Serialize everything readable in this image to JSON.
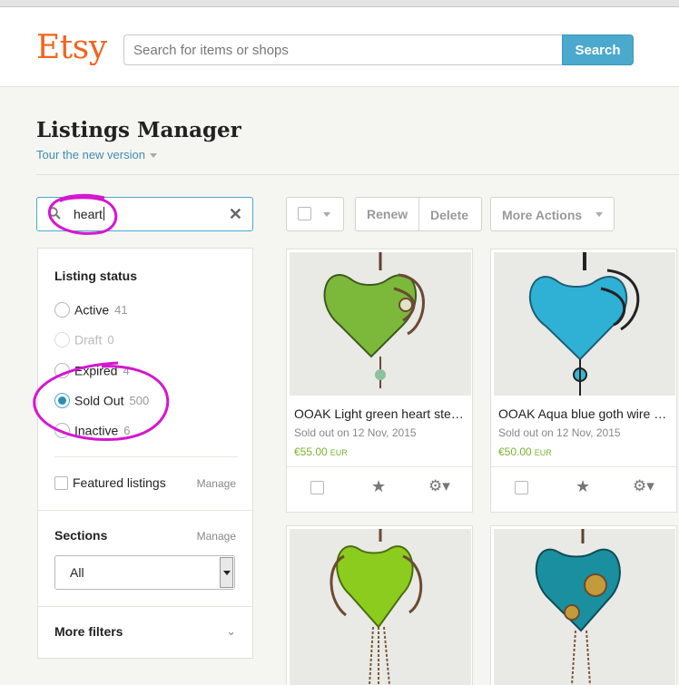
{
  "header": {
    "logo": "Etsy",
    "search_placeholder": "Search for items or shops",
    "search_button": "Search"
  },
  "page": {
    "title": "Listings Manager",
    "tour_link": "Tour the new version"
  },
  "filter": {
    "query": "heart",
    "clear_icon": "close-icon",
    "search_icon": "search-icon"
  },
  "listing_status": {
    "title": "Listing status",
    "options": [
      {
        "label": "Active",
        "count": "41",
        "selected": false,
        "disabled": false
      },
      {
        "label": "Draft",
        "count": "0",
        "selected": false,
        "disabled": true
      },
      {
        "label": "Expired",
        "count": "4",
        "selected": false,
        "disabled": false
      },
      {
        "label": "Sold Out",
        "count": "500",
        "selected": true,
        "disabled": false
      },
      {
        "label": "Inactive",
        "count": "6",
        "selected": false,
        "disabled": false
      }
    ]
  },
  "featured": {
    "label": "Featured listings",
    "manage": "Manage"
  },
  "sections": {
    "title": "Sections",
    "manage": "Manage",
    "selected": "All"
  },
  "more_filters": "More filters",
  "toolbar": {
    "renew": "Renew",
    "delete": "Delete",
    "more_actions": "More Actions"
  },
  "listings": [
    {
      "title": "OOAK Light green heart steampunk wire pendant",
      "sold": "Sold out on 12 Nov, 2015",
      "price": "€55.00",
      "currency": "EUR",
      "heart_color": "#7cb83a"
    },
    {
      "title": "OOAK Aqua blue goth wire wrapped heart pendant",
      "sold": "Sold out on 12 Nov, 2015",
      "price": "€50.00",
      "currency": "EUR",
      "heart_color": "#2fb1d6"
    },
    {
      "title": "",
      "sold": "",
      "price": "",
      "currency": "",
      "heart_color": "#8ccc1e"
    },
    {
      "title": "",
      "sold": "",
      "price": "",
      "currency": "",
      "heart_color": "#1a8fa0"
    }
  ],
  "annotation_color": "#d417d0"
}
